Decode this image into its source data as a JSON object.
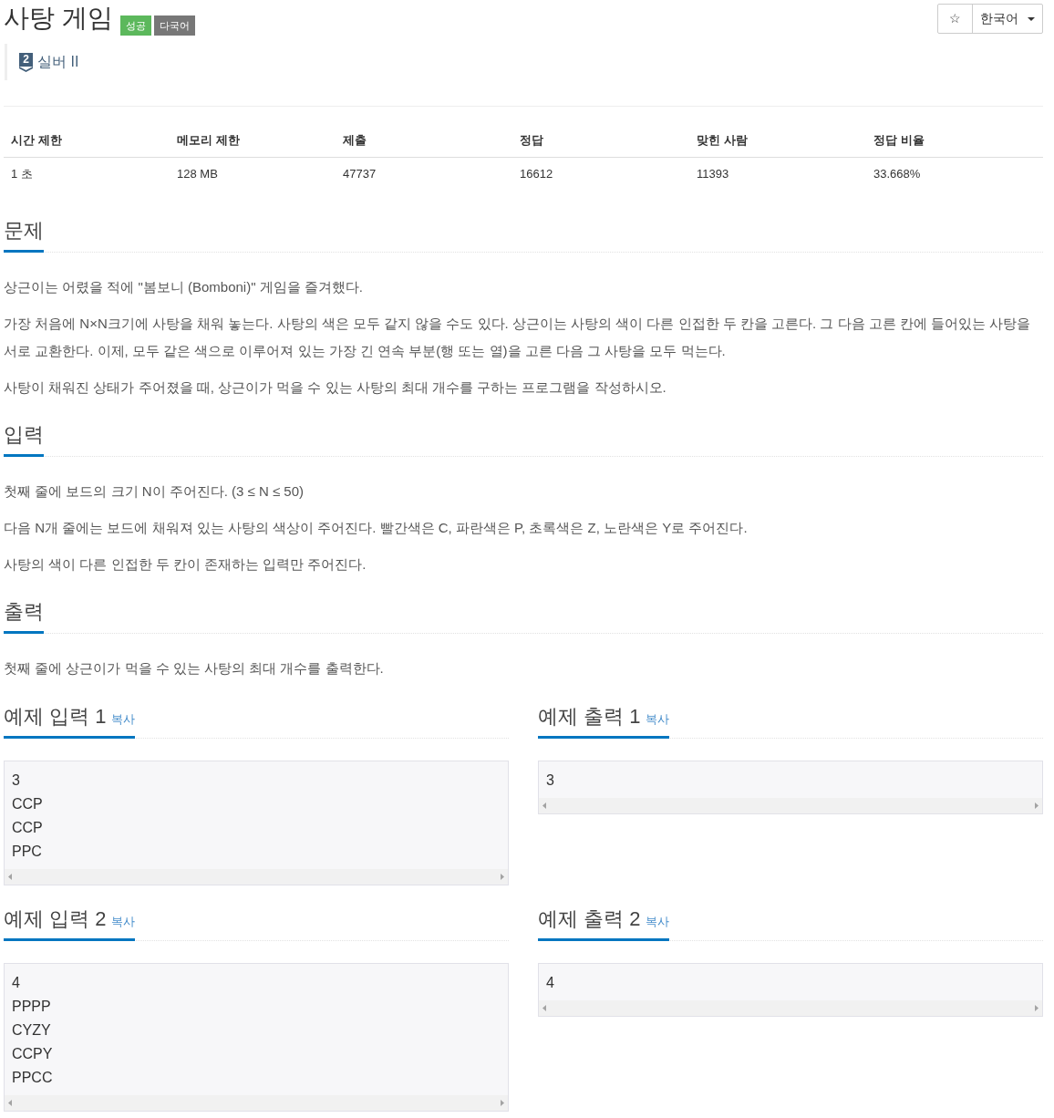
{
  "header": {
    "title": "사탕 게임",
    "badges": [
      {
        "label": "성공",
        "color": "#5cb85c"
      },
      {
        "label": "다국어",
        "color": "#777777"
      }
    ]
  },
  "actions": {
    "favorite": "☆",
    "language": "한국어"
  },
  "tier": {
    "rank_number": "2",
    "name": "실버 II"
  },
  "stats_table": {
    "columns": [
      "시간 제한",
      "메모리 제한",
      "제출",
      "정답",
      "맞힌 사람",
      "정답 비율"
    ],
    "rows": [
      [
        "1 초",
        "128 MB",
        "47737",
        "16612",
        "11393",
        "33.668%"
      ]
    ]
  },
  "sections": [
    {
      "heading": "문제",
      "paragraphs": [
        "상근이는 어렸을 적에 \"봄보니 (Bomboni)\" 게임을 즐겨했다.",
        "가장 처음에 N×N크기에 사탕을 채워 놓는다. 사탕의 색은 모두 같지 않을 수도 있다. 상근이는 사탕의 색이 다른 인접한 두 칸을 고른다. 그 다음 고른 칸에 들어있는 사탕을 서로 교환한다. 이제, 모두 같은 색으로 이루어져 있는 가장 긴 연속 부분(행 또는 열)을 고른 다음 그 사탕을 모두 먹는다.",
        "사탕이 채워진 상태가 주어졌을 때, 상근이가 먹을 수 있는 사탕의 최대 개수를 구하는 프로그램을 작성하시오."
      ]
    },
    {
      "heading": "입력",
      "paragraphs": [
        "첫째 줄에 보드의 크기 N이 주어진다. (3 ≤ N ≤ 50)",
        "다음 N개 줄에는 보드에 채워져 있는 사탕의 색상이 주어진다. 빨간색은 C, 파란색은 P, 초록색은 Z, 노란색은 Y로 주어진다.",
        "사탕의 색이 다른 인접한 두 칸이 존재하는 입력만 주어진다."
      ]
    },
    {
      "heading": "출력",
      "paragraphs": [
        "첫째 줄에 상근이가 먹을 수 있는 사탕의 최대 개수를 출력한다."
      ]
    }
  ],
  "samples": [
    {
      "title": "예제 입력 1",
      "copy_link": "복사",
      "lines": [
        "3",
        "CCP",
        "CCP",
        "PPC"
      ]
    },
    {
      "title": "예제 출력 1",
      "copy_link": "복사",
      "lines": [
        "3"
      ]
    },
    {
      "title": "예제 입력 2",
      "copy_link": "복사",
      "lines": [
        "4",
        "PPPP",
        "CYZY",
        "CCPY",
        "PPCC"
      ]
    },
    {
      "title": "예제 출력 2",
      "copy_link": "복사",
      "lines": [
        "4"
      ]
    }
  ]
}
